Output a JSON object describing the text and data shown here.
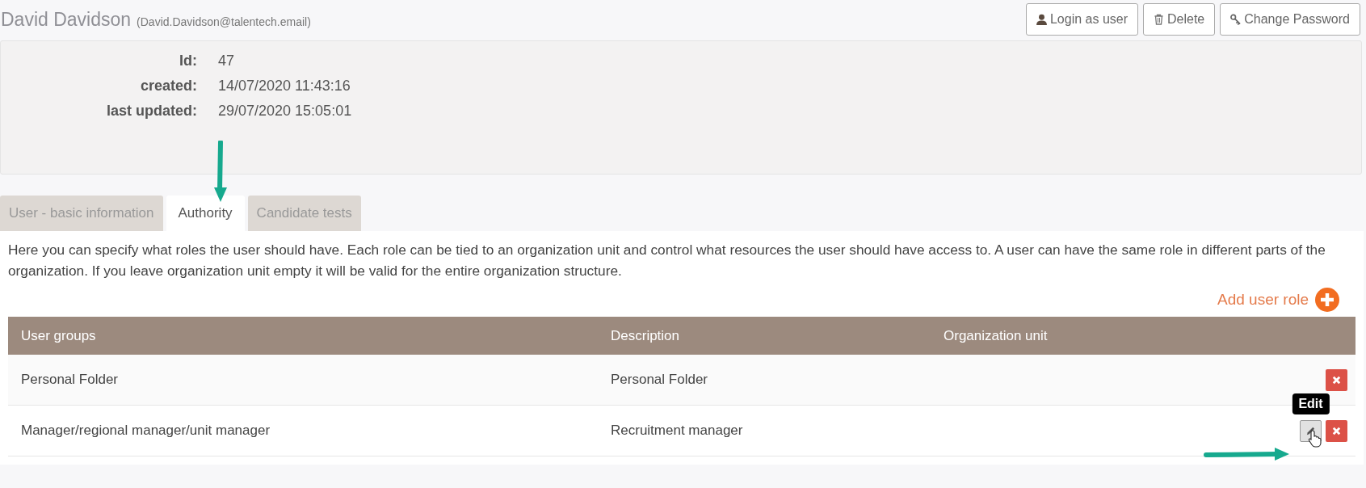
{
  "user": {
    "name": "David Davidson",
    "email": "(David.Davidson@talentech.email)"
  },
  "actions": [
    {
      "kind": "login",
      "label": "Login as user"
    },
    {
      "kind": "delete",
      "label": "Delete"
    },
    {
      "kind": "password",
      "label": "Change Password"
    }
  ],
  "info": [
    {
      "label": "Id:",
      "value": "47"
    },
    {
      "label": "created:",
      "value": "14/07/2020 11:43:16"
    },
    {
      "label": "last updated:",
      "value": "29/07/2020 15:05:01"
    }
  ],
  "tabs": [
    {
      "label": "User - basic information",
      "selected": false
    },
    {
      "label": "Authority",
      "selected": true
    },
    {
      "label": "Candidate tests",
      "selected": false
    }
  ],
  "description": "Here you can specify what roles the user should have. Each role can be tied to an organization unit and control what resources the user should have access to. A user can have the same role in different parts of the organization. If you leave organization unit empty it will be valid for the entire organization structure.",
  "add_role": {
    "label": "Add user role"
  },
  "table": {
    "columns": [
      "User groups",
      "Description",
      "Organization unit"
    ],
    "rows": [
      {
        "user_group": "Personal Folder",
        "description": "Personal Folder",
        "buttons": [
          {
            "kind": "delete",
            "hovered": false
          }
        ]
      },
      {
        "user_group": "Manager/regional manager/unit manager",
        "description": "Recruitment manager",
        "buttons": [
          {
            "kind": "edit",
            "hovered": true,
            "tooltip": "Edit"
          },
          {
            "kind": "delete",
            "hovered": false
          }
        ]
      }
    ]
  }
}
